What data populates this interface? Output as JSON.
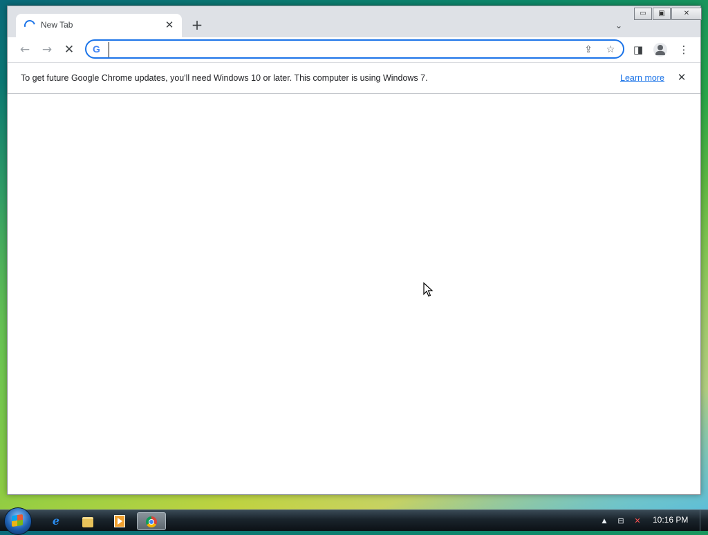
{
  "browser": {
    "tab": {
      "title": "New Tab",
      "close_glyph": "✕",
      "spinner_icon": "loading-spinner-icon"
    },
    "new_tab_glyph": "+",
    "tab_search_glyph": "⌄",
    "window_controls": {
      "minimize": "▭",
      "maximize": "▣",
      "close": "✕"
    },
    "toolbar": {
      "back_glyph": "←",
      "forward_glyph": "→",
      "stop_glyph": "✕",
      "omnibox": {
        "value": "",
        "placeholder": "",
        "provider_logo": "G"
      },
      "share_glyph": "⇪",
      "bookmark_glyph": "☆",
      "side_panel_glyph": "◨",
      "menu_glyph": "⋮"
    },
    "infobar": {
      "message": "To get future Google Chrome updates, you'll need Windows 10 or later. This computer is using Windows 7.",
      "link": "Learn more",
      "close_glyph": "✕"
    }
  },
  "taskbar": {
    "apps": [
      {
        "name": "Internet Explorer",
        "icon": "ie-icon",
        "glyph": "e"
      },
      {
        "name": "Windows Explorer",
        "icon": "folder-icon"
      },
      {
        "name": "Windows Media Player",
        "icon": "media-player-icon"
      },
      {
        "name": "Google Chrome",
        "icon": "chrome-icon",
        "active": true
      }
    ],
    "tray": {
      "show_hidden_glyph": "▲",
      "network_glyph": "⊟",
      "volume_glyph": "✕"
    },
    "clock": "10:16 PM"
  },
  "colors": {
    "accent": "#1a73e8",
    "tabstrip": "#dee1e6",
    "page_bg": "#ffffff"
  }
}
